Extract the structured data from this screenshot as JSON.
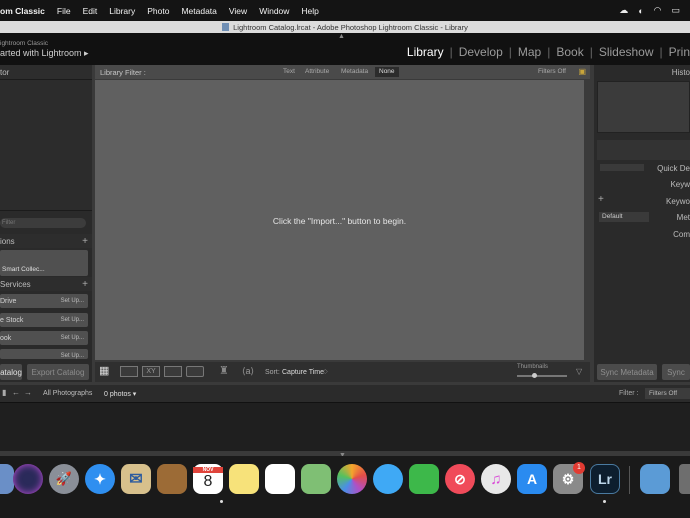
{
  "menubar": {
    "app_name": "om Classic",
    "items": [
      "File",
      "Edit",
      "Library",
      "Photo",
      "Metadata",
      "View",
      "Window",
      "Help"
    ]
  },
  "window": {
    "title": "Lightroom Catalog.lrcat - Adobe Photoshop Lightroom Classic - Library"
  },
  "identity": {
    "small_text": "ightroom Classic",
    "big_text": "arted with Lightroom  ▸"
  },
  "modules": [
    "Library",
    "Develop",
    "Map",
    "Book",
    "Slideshow",
    "Prin"
  ],
  "left_panel": {
    "navigator_header": "tor",
    "filter_placeholder": "Filter",
    "collections_header": "ions",
    "smart_collections": "Smart Collec...",
    "publish_header": "Services",
    "services": [
      {
        "name": "Drive",
        "setup": "Set Up..."
      },
      {
        "name": "e Stock",
        "setup": "Set Up..."
      },
      {
        "name": "ook",
        "setup": "Set Up..."
      },
      {
        "name": "",
        "setup": "Set Up..."
      }
    ],
    "import_button": "atalog",
    "export_button": "Export Catalog"
  },
  "library_filter": {
    "label": "Library Filter :",
    "options": [
      "Text",
      "Attribute",
      "Metadata",
      "None"
    ],
    "filters_off": "Filters Off"
  },
  "grid": {
    "message": "Click the \"Import...\" button to begin."
  },
  "toolbar": {
    "sort_label": "Sort:",
    "sort_value": "Capture Time",
    "thumbnails_label": "Thumbnails"
  },
  "right_panel": {
    "histogram_header": "Histo",
    "quick_develop": "Quick De",
    "keywording": "Keyw",
    "keyword_list": "Keywo",
    "metadata_preset": "Default",
    "metadata": "Met",
    "comments": "Com",
    "sync_metadata": "Sync Metadata",
    "sync_settings": "Sync"
  },
  "filmstrip": {
    "source": "All Photographs",
    "count": "0 photos  ▾",
    "filter_label": "Filter :",
    "filter_value": "Filters Off"
  },
  "dock": {
    "calendar_month": "NOV",
    "calendar_day": "8",
    "badge": "1",
    "lightroom_label": "Lr"
  }
}
